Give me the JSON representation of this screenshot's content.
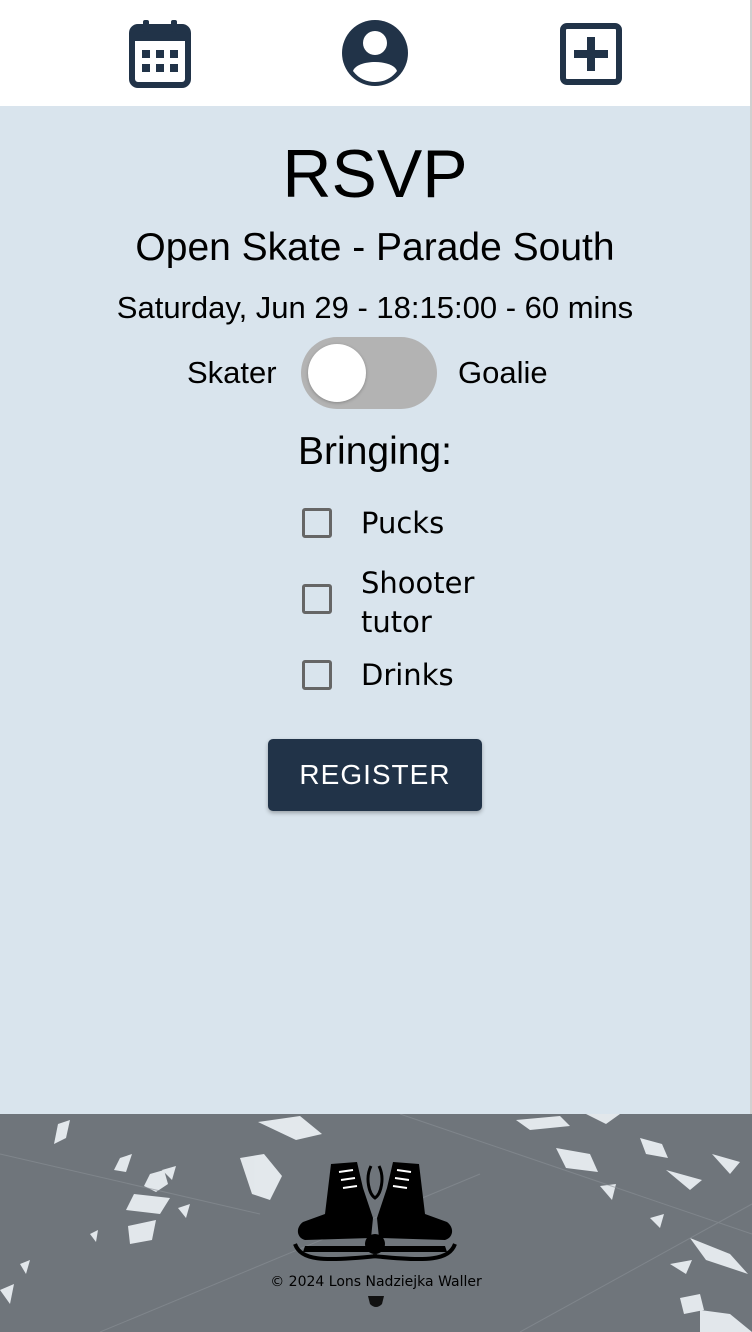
{
  "nav": {
    "items": [
      {
        "name": "calendar",
        "icon": "calendar-icon"
      },
      {
        "name": "profile",
        "icon": "user-circle-icon"
      },
      {
        "name": "add",
        "icon": "plus-square-icon"
      }
    ]
  },
  "page": {
    "title": "RSVP",
    "event_name": "Open Skate - Parade South",
    "event_when": "Saturday, Jun 29 - 18:15:00 - 60 mins"
  },
  "role_toggle": {
    "left_label": "Skater",
    "right_label": "Goalie",
    "selected": "Skater"
  },
  "bringing": {
    "heading": "Bringing:",
    "items": [
      {
        "label": "Pucks",
        "checked": false
      },
      {
        "label": "Shooter tutor",
        "checked": false
      },
      {
        "label": "Drinks",
        "checked": false
      }
    ]
  },
  "actions": {
    "register_label": "REGISTER"
  },
  "footer": {
    "copyright": "© 2024 Lons Nadziejka Waller",
    "logo_icon": "ice-skates-icon"
  },
  "colors": {
    "primary": "#213348",
    "background": "#d9e4ed",
    "toggle_track": "#b3b3b3",
    "nav_icon": "#213348"
  }
}
